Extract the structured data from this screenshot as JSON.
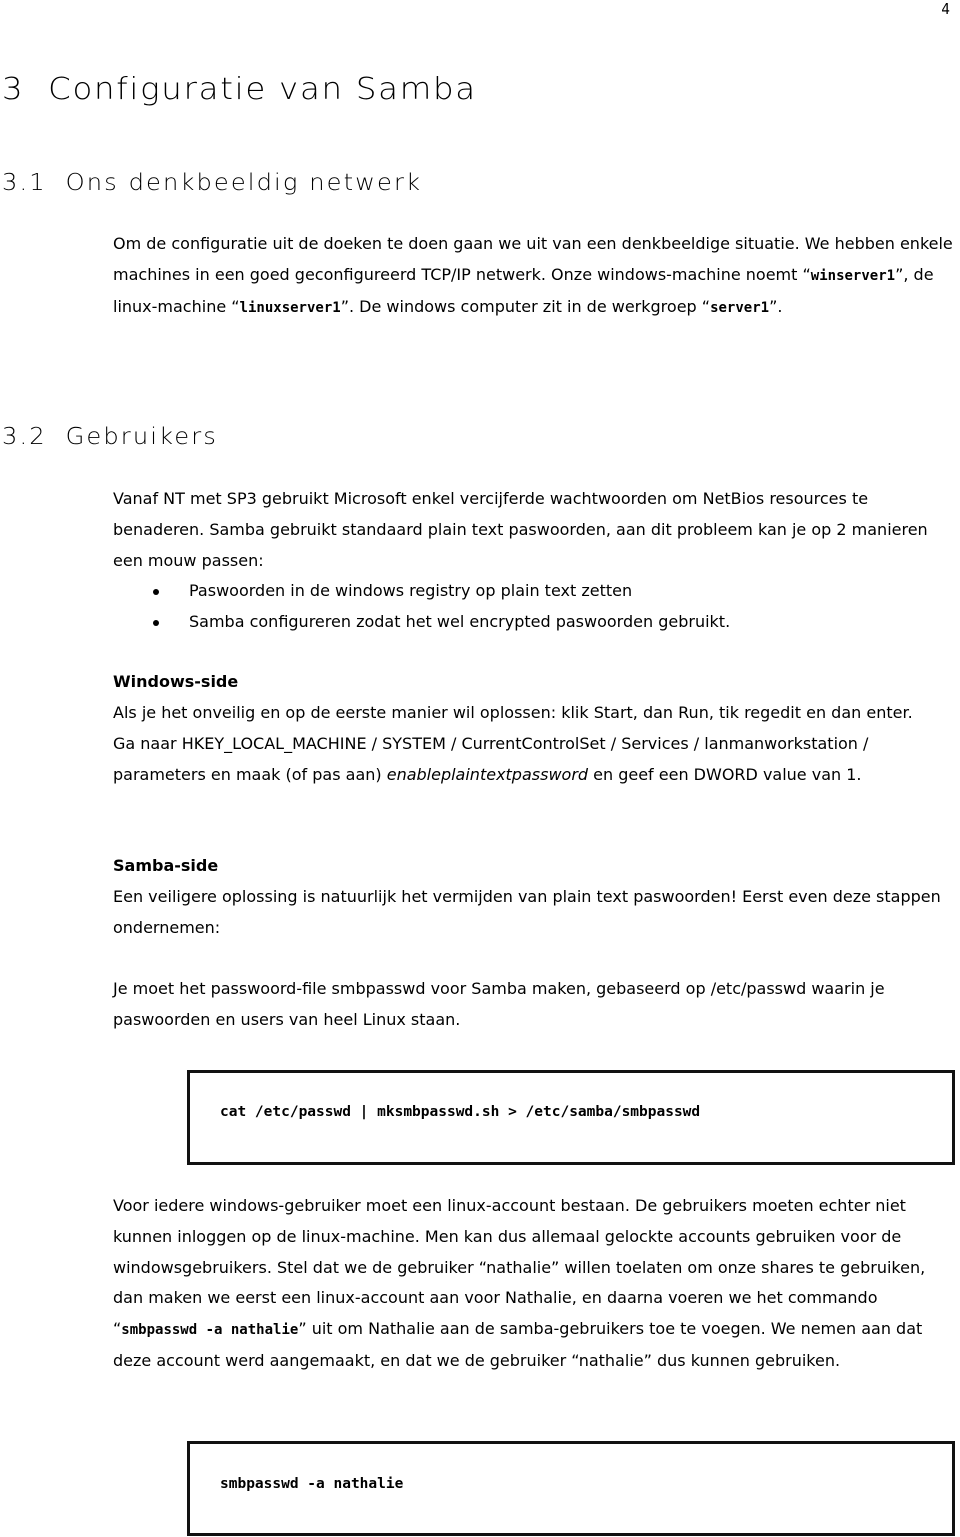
{
  "page_number": "4",
  "chapter": {
    "number": "3",
    "title": "Configuratie van Samba"
  },
  "section1": {
    "number": "3.1",
    "title": "Ons denkbeeldig netwerk",
    "paragraph": {
      "t1": "Om de configuratie uit de doeken te doen gaan we uit van een denkbeeldige situatie.  We hebben enkele machines in een goed geconfigureerd TCP/IP netwerk.  Onze windows-machine noemt “",
      "code1": "winserver1",
      "t2": "”, de linux-machine “",
      "code2": "linuxserver1",
      "t3": "”.  De windows computer zit in de werkgroep “",
      "code3": "server1",
      "t4": "”."
    }
  },
  "section2": {
    "number": "3.2",
    "title": "Gebruikers",
    "intro": "Vanaf NT met SP3 gebruikt Microsoft enkel vercijferde wachtwoorden om NetBios resources te benaderen.  Samba gebruikt standaard plain text paswoorden, aan dit probleem kan je op 2 manieren een mouw passen:",
    "bullets": [
      "Paswoorden in de windows registry op plain text zetten",
      "Samba configureren zodat het wel encrypted paswoorden gebruikt."
    ],
    "windows_side": {
      "heading": "Windows-side",
      "t1": "Als je het onveilig en op de eerste manier wil oplossen: klik Start, dan Run, tik regedit en dan enter.  Ga naar HKEY_LOCAL_MACHINE / SYSTEM / CurrentControlSet / Services / lanmanworkstation / parameters en maak (of pas aan) ",
      "italic": "enableplaintextpassword",
      "t2": " en geef een DWORD value van 1."
    },
    "samba_side": {
      "heading": "Samba-side",
      "para1": "Een veiligere oplossing is natuurlijk het vermijden van plain text paswoorden!  Eerst even deze stappen ondernemen:",
      "para2": "Je moet het passwoord-file smbpasswd voor Samba maken, gebaseerd op /etc/passwd waarin je paswoorden en users van heel Linux staan.",
      "code_block1": "cat /etc/passwd | mksmbpasswd.sh > /etc/samba/smbpasswd",
      "para3": {
        "t1": "Voor iedere windows-gebruiker moet een linux-account bestaan.  De gebruikers moeten echter niet kunnen inloggen op de linux-machine.  Men kan dus allemaal gelockte accounts gebruiken voor de windowsgebruikers.  Stel dat we de gebruiker “nathalie” willen toelaten om onze shares te gebruiken, dan maken we eerst een linux-account aan voor Nathalie, en daarna voeren we het commando “",
        "code": "smbpasswd -a nathalie",
        "t2": "” uit om Nathalie aan de samba-gebruikers toe te voegen. We nemen aan dat deze account werd aangemaakt, en dat we de gebruiker “nathalie” dus kunnen gebruiken."
      },
      "code_block2": "smbpasswd -a nathalie"
    }
  }
}
